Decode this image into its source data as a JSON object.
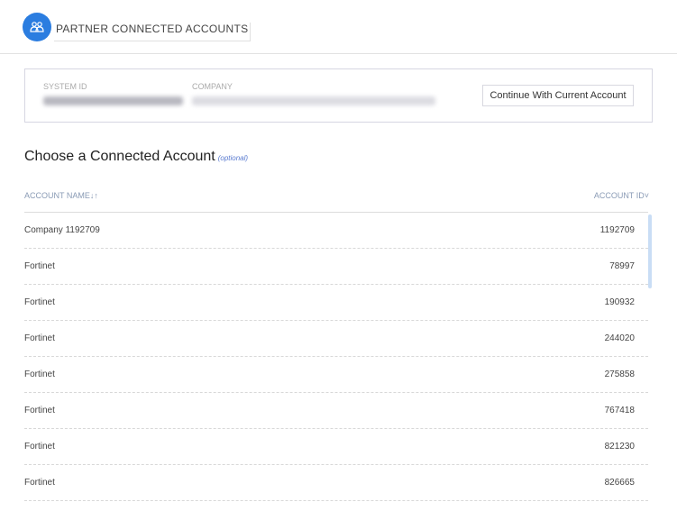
{
  "header": {
    "title": "PARTNER CONNECTED ACCOUNTS",
    "logo_icon": "people-group-icon",
    "accent": "#2b7de0"
  },
  "current": {
    "system_id_label": "SYSTEM ID",
    "company_label": "COMPANY",
    "continue_label": "Continue With Current Account"
  },
  "section": {
    "title": "Choose a Connected Account",
    "optional": "(optional)"
  },
  "table": {
    "columns": [
      "ACCOUNT NAME↓↑",
      "ACCOUNT ID˅"
    ],
    "rows": [
      {
        "name": "Company 1192709",
        "id": "1192709"
      },
      {
        "name": "Fortinet",
        "id": "78997"
      },
      {
        "name": "Fortinet",
        "id": "190932"
      },
      {
        "name": "Fortinet",
        "id": "244020"
      },
      {
        "name": "Fortinet",
        "id": "275858"
      },
      {
        "name": "Fortinet",
        "id": "767418"
      },
      {
        "name": "Fortinet",
        "id": "821230"
      },
      {
        "name": "Fortinet",
        "id": "826665"
      }
    ]
  }
}
